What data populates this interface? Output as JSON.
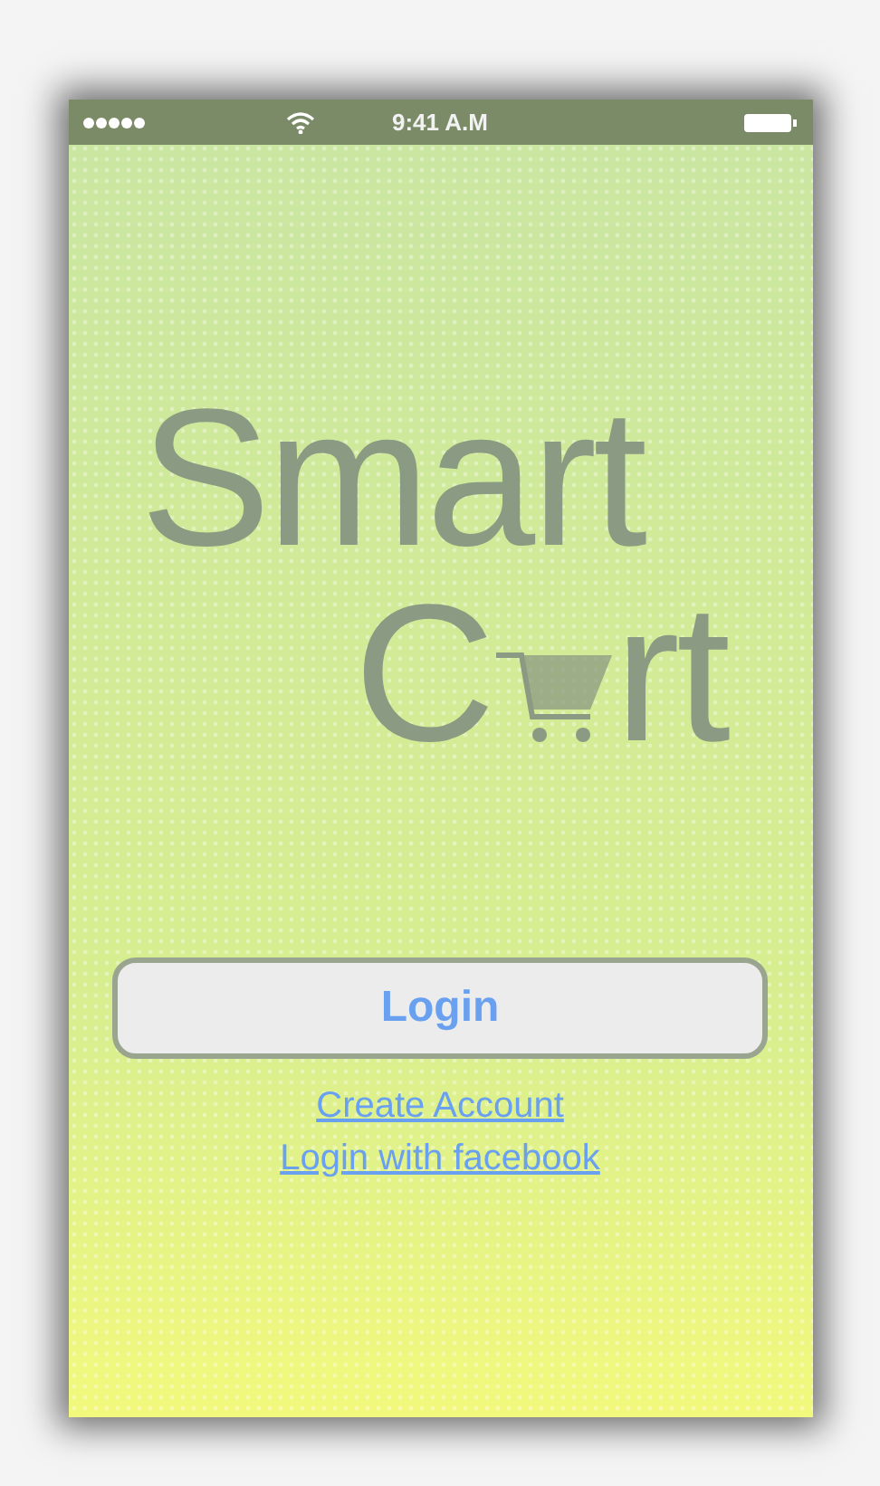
{
  "status_bar": {
    "time": "9:41 A.M"
  },
  "logo": {
    "line_1": "Smart",
    "line_2_start": "C",
    "line_2_end": "rt"
  },
  "login_button": {
    "label": "Login"
  },
  "links": [
    "Create Account",
    "Login with facebook"
  ]
}
